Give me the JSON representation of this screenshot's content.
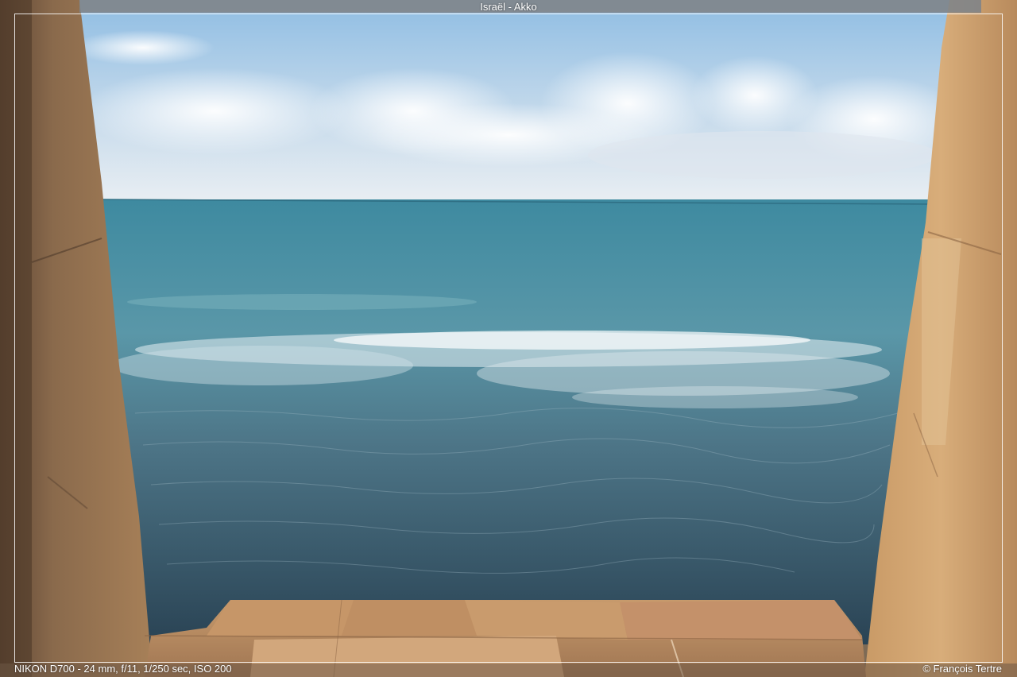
{
  "title": "Israël - Akko",
  "exif": "NIKON D700 - 24 mm, f/11, 1/250 sec, ISO 200",
  "copyright": "© François Tertre",
  "colors": {
    "sky_top": "#9cc4e6",
    "sky_horizon": "#e8eef4",
    "sea_far": "#3f8a9c",
    "sea_near": "#2e4a5c",
    "foam": "#e6eef2",
    "stone": "#c89a6a",
    "stone_shadow": "#6d5440"
  }
}
